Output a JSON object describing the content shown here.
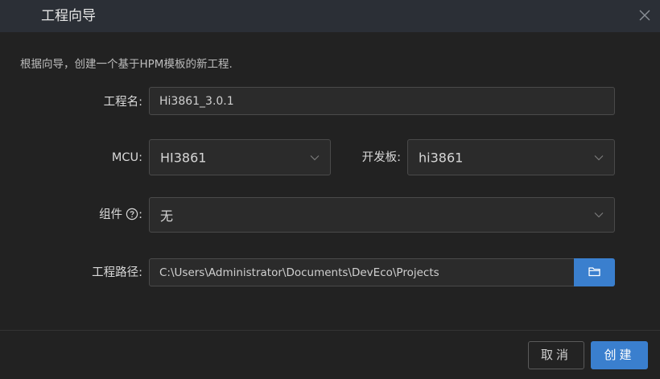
{
  "dialog": {
    "title": "工程向导",
    "description": "根据向导，创建一个基于HPM模板的新工程."
  },
  "form": {
    "project_name": {
      "label": "工程名:",
      "value": "Hi3861_3.0.1"
    },
    "mcu": {
      "label": "MCU:",
      "value": "HI3861"
    },
    "board": {
      "label": "开发板:",
      "value": "hi3861"
    },
    "component": {
      "label": "组件",
      "label_suffix": ":",
      "value": "无"
    },
    "project_path": {
      "label": "工程路径:",
      "value": "C:\\Users\\Administrator\\Documents\\DevEco\\Projects"
    }
  },
  "footer": {
    "cancel_label": "取消",
    "create_label": "创建"
  },
  "icons": {
    "close": "close-icon",
    "chevron": "chevron-down-icon",
    "help": "help-circle-icon",
    "folder": "folder-icon"
  },
  "colors": {
    "accent": "#3a7fce",
    "background": "#222222",
    "titlebar": "#2b2f36"
  }
}
